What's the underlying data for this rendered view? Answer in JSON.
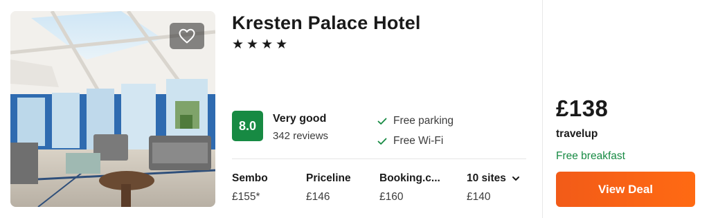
{
  "hotel": {
    "name": "Kresten Palace Hotel",
    "stars": "★★★★",
    "star_count": 4
  },
  "rating": {
    "score": "8.0",
    "label": "Very good",
    "reviews": "342 reviews",
    "badge_color": "#178a43"
  },
  "amenities": [
    {
      "label": "Free parking",
      "icon": "check-icon"
    },
    {
      "label": "Free Wi-Fi",
      "icon": "check-icon"
    }
  ],
  "sites": [
    {
      "name": "Sembo",
      "price": "£155*"
    },
    {
      "name": "Priceline",
      "price": "£146"
    },
    {
      "name": "Booking.c...",
      "price": "£160"
    },
    {
      "name": "10 sites",
      "price": "£140",
      "icon": "chevron-down-icon"
    }
  ],
  "deal": {
    "price": "£138",
    "provider": "travelup",
    "perk": "Free breakfast",
    "button_label": "View Deal",
    "button_color": "#f25b18",
    "perk_color": "#178a43"
  },
  "photo": {
    "favorite_icon": "heart-icon",
    "image": "hotel-lobby-photo"
  }
}
